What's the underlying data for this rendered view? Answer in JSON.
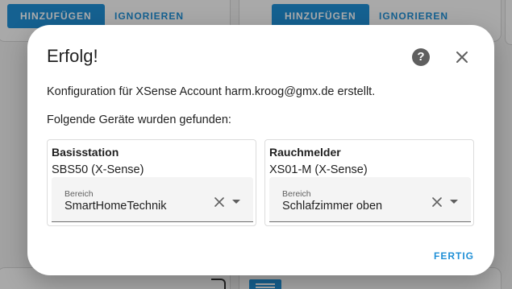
{
  "background": {
    "left_card": {
      "add_label": "HINZUFÜGEN",
      "ignore_label": "IGNORIEREN"
    },
    "right_card": {
      "add_label": "HINZUFÜGEN",
      "ignore_label": "IGNORIEREN"
    },
    "accent_color": "#1f8fd6"
  },
  "dialog": {
    "title": "Erfolg!",
    "help_icon": "help-circle-icon",
    "close_icon": "close-icon",
    "message": "Konfiguration für XSense Account harm.kroog@gmx.de erstellt.",
    "devices_heading": "Folgende Geräte wurden gefunden:",
    "devices": [
      {
        "name": "Basisstation",
        "model": "SBS50 (X-Sense)",
        "area_label": "Bereich",
        "area_value": "SmartHomeTechnik"
      },
      {
        "name": "Rauchmelder",
        "model": "XS01-M (X-Sense)",
        "area_label": "Bereich",
        "area_value": "Schlafzimmer oben"
      }
    ],
    "done_label": "FERTIG"
  }
}
